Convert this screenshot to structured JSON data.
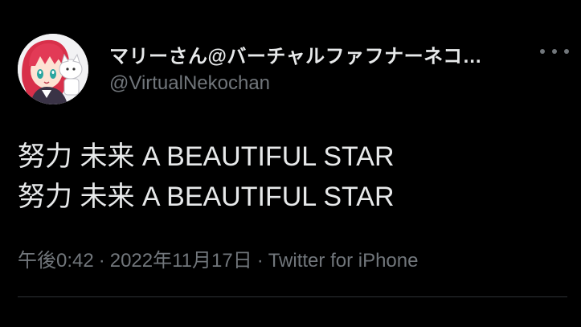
{
  "author": {
    "display_name": "マリーさん@バーチャルファフナーネコ…",
    "handle": "@VirtualNekochan",
    "avatar_icon": "anime-girl-avatar-icon"
  },
  "more_icon": "more-horizontal-icon",
  "tweet": {
    "lines": [
      "努力 未来 A BEAUTIFUL STAR",
      "努力 未来 A BEAUTIFUL STAR"
    ]
  },
  "meta": {
    "time": "午後0:42",
    "separator": "·",
    "date": "2022年11月17日",
    "source": "Twitter for iPhone"
  },
  "colors": {
    "background": "#000000",
    "primary_text": "#e7e9ea",
    "secondary_text": "#71767b",
    "divider": "#2f3336"
  }
}
